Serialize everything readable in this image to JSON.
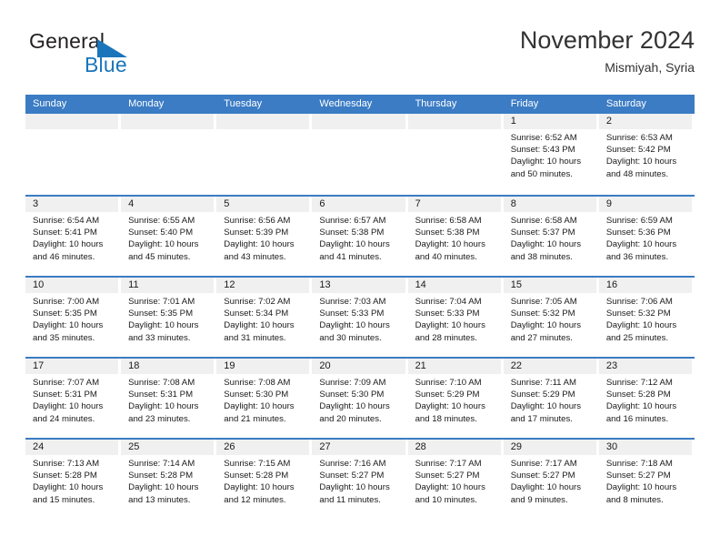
{
  "brand": {
    "name_part1": "General",
    "name_part2": "Blue",
    "triangle_color": "#1b75bb"
  },
  "header": {
    "title": "November 2024",
    "subtitle": "Mismiyah, Syria"
  },
  "theme": {
    "header_blue": "#3b7cc4",
    "daynum_gray": "#f0f0f0",
    "text": "#1a1a1a"
  },
  "labels": {
    "sunrise": "Sunrise:",
    "sunset": "Sunset:",
    "daylight": "Daylight:"
  },
  "weekdays": [
    "Sunday",
    "Monday",
    "Tuesday",
    "Wednesday",
    "Thursday",
    "Friday",
    "Saturday"
  ],
  "weeks": [
    [
      {
        "day": ""
      },
      {
        "day": ""
      },
      {
        "day": ""
      },
      {
        "day": ""
      },
      {
        "day": ""
      },
      {
        "day": "1",
        "sunrise": "Sunrise: 6:52 AM",
        "sunset": "Sunset: 5:43 PM",
        "daylight": "Daylight: 10 hours and 50 minutes."
      },
      {
        "day": "2",
        "sunrise": "Sunrise: 6:53 AM",
        "sunset": "Sunset: 5:42 PM",
        "daylight": "Daylight: 10 hours and 48 minutes."
      }
    ],
    [
      {
        "day": "3",
        "sunrise": "Sunrise: 6:54 AM",
        "sunset": "Sunset: 5:41 PM",
        "daylight": "Daylight: 10 hours and 46 minutes."
      },
      {
        "day": "4",
        "sunrise": "Sunrise: 6:55 AM",
        "sunset": "Sunset: 5:40 PM",
        "daylight": "Daylight: 10 hours and 45 minutes."
      },
      {
        "day": "5",
        "sunrise": "Sunrise: 6:56 AM",
        "sunset": "Sunset: 5:39 PM",
        "daylight": "Daylight: 10 hours and 43 minutes."
      },
      {
        "day": "6",
        "sunrise": "Sunrise: 6:57 AM",
        "sunset": "Sunset: 5:38 PM",
        "daylight": "Daylight: 10 hours and 41 minutes."
      },
      {
        "day": "7",
        "sunrise": "Sunrise: 6:58 AM",
        "sunset": "Sunset: 5:38 PM",
        "daylight": "Daylight: 10 hours and 40 minutes."
      },
      {
        "day": "8",
        "sunrise": "Sunrise: 6:58 AM",
        "sunset": "Sunset: 5:37 PM",
        "daylight": "Daylight: 10 hours and 38 minutes."
      },
      {
        "day": "9",
        "sunrise": "Sunrise: 6:59 AM",
        "sunset": "Sunset: 5:36 PM",
        "daylight": "Daylight: 10 hours and 36 minutes."
      }
    ],
    [
      {
        "day": "10",
        "sunrise": "Sunrise: 7:00 AM",
        "sunset": "Sunset: 5:35 PM",
        "daylight": "Daylight: 10 hours and 35 minutes."
      },
      {
        "day": "11",
        "sunrise": "Sunrise: 7:01 AM",
        "sunset": "Sunset: 5:35 PM",
        "daylight": "Daylight: 10 hours and 33 minutes."
      },
      {
        "day": "12",
        "sunrise": "Sunrise: 7:02 AM",
        "sunset": "Sunset: 5:34 PM",
        "daylight": "Daylight: 10 hours and 31 minutes."
      },
      {
        "day": "13",
        "sunrise": "Sunrise: 7:03 AM",
        "sunset": "Sunset: 5:33 PM",
        "daylight": "Daylight: 10 hours and 30 minutes."
      },
      {
        "day": "14",
        "sunrise": "Sunrise: 7:04 AM",
        "sunset": "Sunset: 5:33 PM",
        "daylight": "Daylight: 10 hours and 28 minutes."
      },
      {
        "day": "15",
        "sunrise": "Sunrise: 7:05 AM",
        "sunset": "Sunset: 5:32 PM",
        "daylight": "Daylight: 10 hours and 27 minutes."
      },
      {
        "day": "16",
        "sunrise": "Sunrise: 7:06 AM",
        "sunset": "Sunset: 5:32 PM",
        "daylight": "Daylight: 10 hours and 25 minutes."
      }
    ],
    [
      {
        "day": "17",
        "sunrise": "Sunrise: 7:07 AM",
        "sunset": "Sunset: 5:31 PM",
        "daylight": "Daylight: 10 hours and 24 minutes."
      },
      {
        "day": "18",
        "sunrise": "Sunrise: 7:08 AM",
        "sunset": "Sunset: 5:31 PM",
        "daylight": "Daylight: 10 hours and 23 minutes."
      },
      {
        "day": "19",
        "sunrise": "Sunrise: 7:08 AM",
        "sunset": "Sunset: 5:30 PM",
        "daylight": "Daylight: 10 hours and 21 minutes."
      },
      {
        "day": "20",
        "sunrise": "Sunrise: 7:09 AM",
        "sunset": "Sunset: 5:30 PM",
        "daylight": "Daylight: 10 hours and 20 minutes."
      },
      {
        "day": "21",
        "sunrise": "Sunrise: 7:10 AM",
        "sunset": "Sunset: 5:29 PM",
        "daylight": "Daylight: 10 hours and 18 minutes."
      },
      {
        "day": "22",
        "sunrise": "Sunrise: 7:11 AM",
        "sunset": "Sunset: 5:29 PM",
        "daylight": "Daylight: 10 hours and 17 minutes."
      },
      {
        "day": "23",
        "sunrise": "Sunrise: 7:12 AM",
        "sunset": "Sunset: 5:28 PM",
        "daylight": "Daylight: 10 hours and 16 minutes."
      }
    ],
    [
      {
        "day": "24",
        "sunrise": "Sunrise: 7:13 AM",
        "sunset": "Sunset: 5:28 PM",
        "daylight": "Daylight: 10 hours and 15 minutes."
      },
      {
        "day": "25",
        "sunrise": "Sunrise: 7:14 AM",
        "sunset": "Sunset: 5:28 PM",
        "daylight": "Daylight: 10 hours and 13 minutes."
      },
      {
        "day": "26",
        "sunrise": "Sunrise: 7:15 AM",
        "sunset": "Sunset: 5:28 PM",
        "daylight": "Daylight: 10 hours and 12 minutes."
      },
      {
        "day": "27",
        "sunrise": "Sunrise: 7:16 AM",
        "sunset": "Sunset: 5:27 PM",
        "daylight": "Daylight: 10 hours and 11 minutes."
      },
      {
        "day": "28",
        "sunrise": "Sunrise: 7:17 AM",
        "sunset": "Sunset: 5:27 PM",
        "daylight": "Daylight: 10 hours and 10 minutes."
      },
      {
        "day": "29",
        "sunrise": "Sunrise: 7:17 AM",
        "sunset": "Sunset: 5:27 PM",
        "daylight": "Daylight: 10 hours and 9 minutes."
      },
      {
        "day": "30",
        "sunrise": "Sunrise: 7:18 AM",
        "sunset": "Sunset: 5:27 PM",
        "daylight": "Daylight: 10 hours and 8 minutes."
      }
    ]
  ]
}
